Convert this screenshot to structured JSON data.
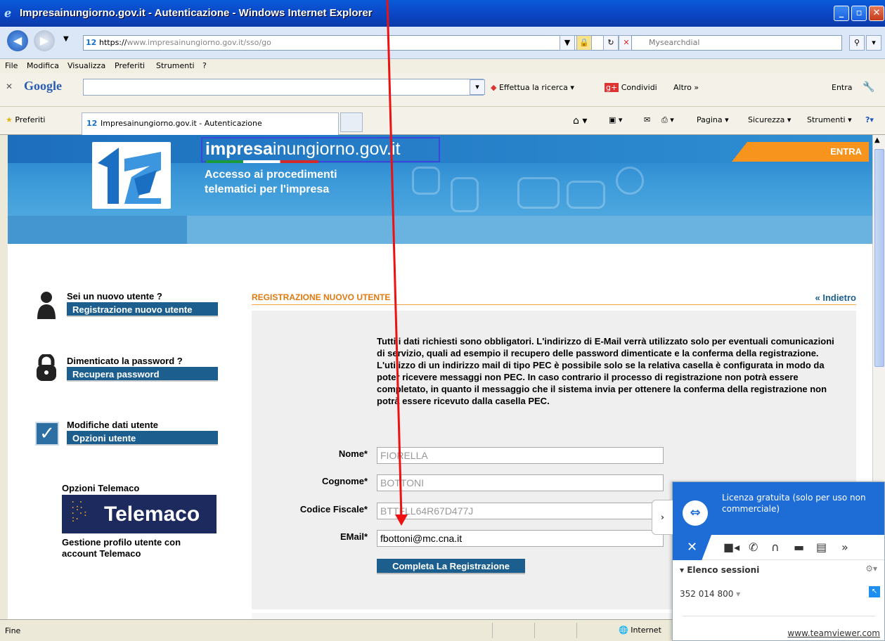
{
  "window": {
    "title": "Impresainungiorno.gov.it - Autenticazione - Windows Internet Explorer"
  },
  "address": {
    "protocol": "https://",
    "domain": "www.impresainungiorno.gov.it",
    "path": "/sso/go",
    "search_placeholder": "Mysearchdial"
  },
  "menu": [
    "File",
    "Modifica",
    "Visualizza",
    "Preferiti",
    "Strumenti",
    "?"
  ],
  "google_toolbar": {
    "logo": "Google",
    "search_label": "Effettua la ricerca",
    "share_label": "Condividi",
    "more_label": "Altro »",
    "login_label": "Entra"
  },
  "favorites_bar": {
    "favorites_label": "Preferiti",
    "tab_title": "Impresainungiorno.gov.it - Autenticazione",
    "commands": [
      "Pagina",
      "Sicurezza",
      "Strumenti"
    ]
  },
  "banner": {
    "site_prefix": "impresa",
    "site_suffix": "inungiorno.gov.it",
    "subtitle": "Accesso ai procedimenti telematici per l'impresa",
    "login_label": "ENTRA"
  },
  "sidebar": {
    "new_user": {
      "question": "Sei un nuovo utente ?",
      "button": "Registrazione nuovo utente"
    },
    "forgot": {
      "question": "Dimenticato la password ?",
      "button": "Recupera password"
    },
    "modify": {
      "question": "Modifiche dati utente",
      "button": "Opzioni utente"
    },
    "telemaco": {
      "heading": "Opzioni Telemaco",
      "logo_text": "elemaco",
      "logo_letter": "T",
      "description": "Gestione profilo utente con account Telemaco"
    }
  },
  "form": {
    "section_title": "REGISTRAZIONE NUOVO UTENTE",
    "back_link": "« Indietro",
    "info": "Tutti i dati richiesti sono obbligatori. L'indirizzo di E-Mail verrà utilizzato solo per eventuali comunicazioni di servizio, quali ad esempio il recupero delle password dimenticate e la conferma della registrazione. L'utilizzo di un indirizzo mail di tipo PEC è possibile solo se la relativa casella è configurata in modo da poter ricevere messaggi non PEC. In caso contrario il processo di registrazione non potrà essere completato, in quanto il messaggio che il sistema invia per ottenere la conferma della registrazione non potrà essere ricevuto dalla casella PEC.",
    "fields": [
      {
        "label": "Nome*",
        "value": "FIORELLA"
      },
      {
        "label": "Cognome*",
        "value": "BOTTONI"
      },
      {
        "label": "Codice Fiscale*",
        "value": "BTTFLL64R67D477J"
      },
      {
        "label": "EMail*",
        "value": "fbottoni@mc.cna.it"
      }
    ],
    "submit": "Completa La Registrazione"
  },
  "statusbar": {
    "left": "Fine",
    "zone": "Internet"
  },
  "teamviewer": {
    "licence": "Licenza gratuita (solo per uso non commerciale)",
    "sessions_label": "Elenco sessioni",
    "session_id": "352 014 800",
    "link": "www.teamviewer.com"
  },
  "colors": {
    "banner_blue": "#1f7bc9",
    "nav_button": "#1c5f8f",
    "accent_orange": "#f7941d",
    "annotation_arrow": "#ee1111"
  }
}
